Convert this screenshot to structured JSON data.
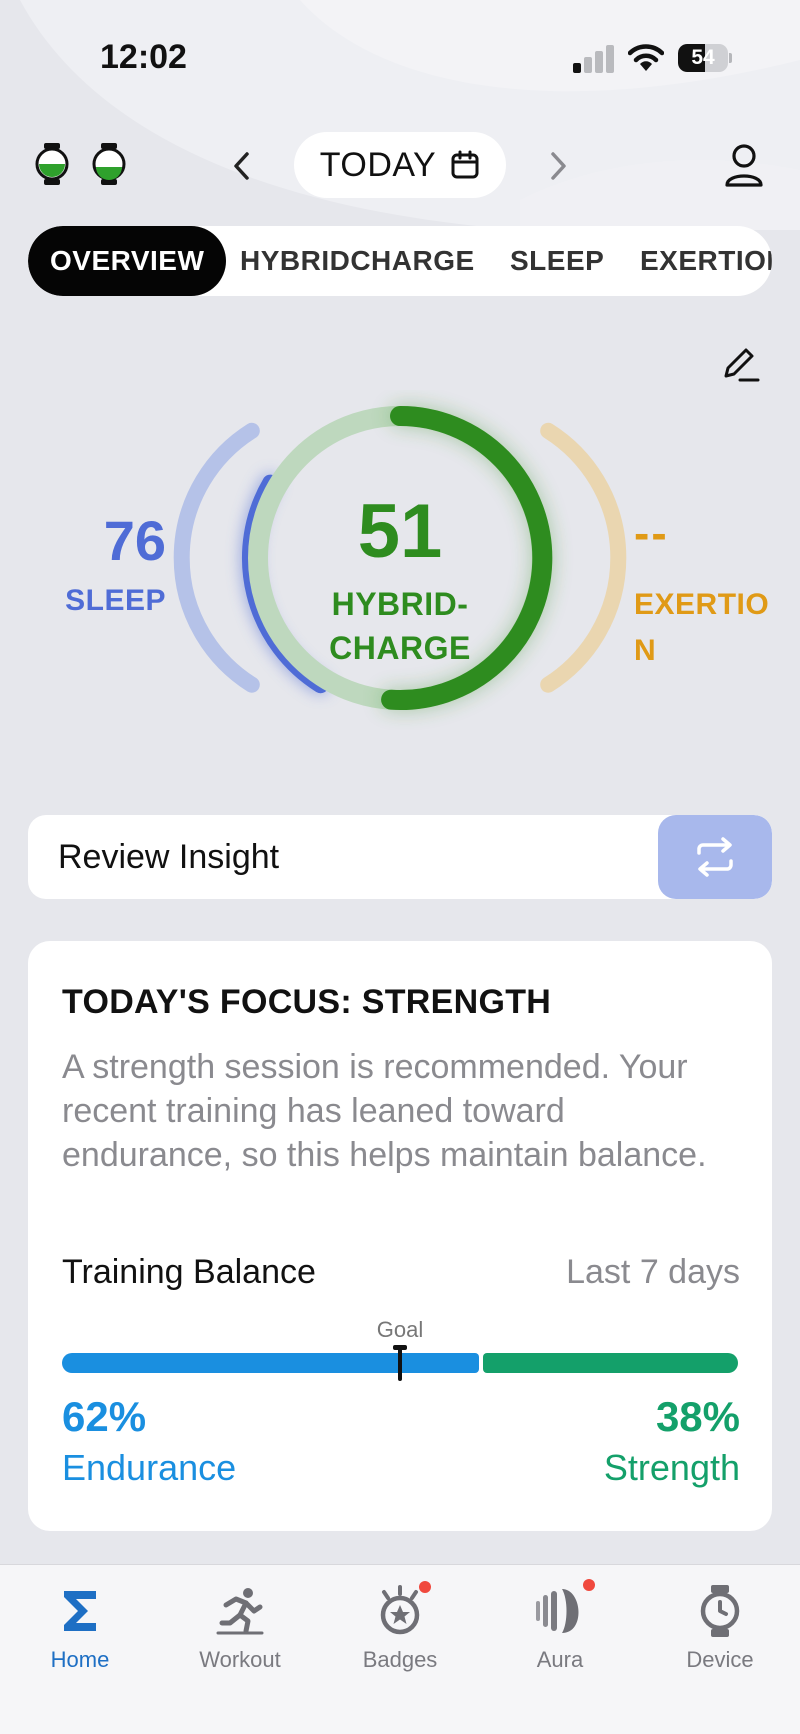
{
  "status_bar": {
    "time": "12:02",
    "battery": "54",
    "battery_level_percent": 54
  },
  "header": {
    "date_label": "TODAY",
    "icons": [
      "watch-icon",
      "watch-icon",
      "chevron-left-icon",
      "calendar-icon",
      "chevron-right-icon",
      "profile-icon"
    ]
  },
  "tabs": [
    {
      "label": "OVERVIEW",
      "active": true
    },
    {
      "label": "HYBRIDCHARGE",
      "active": false
    },
    {
      "label": "SLEEP",
      "active": false
    },
    {
      "label": "EXERTION",
      "active": false
    }
  ],
  "scores": {
    "sleep": {
      "value": "76",
      "label": "SLEEP",
      "color": "#4f6cd6"
    },
    "hybridcharge": {
      "value": "51",
      "label_line1": "HYBRID-",
      "label_line2": "CHARGE",
      "fill_percent": 51,
      "color": "#2e8c1f"
    },
    "exertion": {
      "value": "--",
      "label": "EXERTION",
      "color": "#e09a16"
    }
  },
  "review": {
    "label": "Review Insight"
  },
  "focus": {
    "title": "TODAY'S FOCUS: STRENGTH",
    "description": "A strength session is recommended. Your recent training has leaned toward endurance, so this helps maintain balance.",
    "balance_title": "Training Balance",
    "balance_period": "Last 7 days",
    "goal_label": "Goal",
    "goal_percent": 50,
    "endurance": {
      "percent": "62%",
      "value": 62,
      "label": "Endurance",
      "color": "#1a8fe0"
    },
    "strength": {
      "percent": "38%",
      "value": 38,
      "label": "Strength",
      "color": "#14a06a"
    }
  },
  "bottom_nav": [
    {
      "label": "Home",
      "icon": "sigma-icon",
      "active": true,
      "badge": false
    },
    {
      "label": "Workout",
      "icon": "running-icon",
      "active": false,
      "badge": false
    },
    {
      "label": "Badges",
      "icon": "medal-icon",
      "active": false,
      "badge": true
    },
    {
      "label": "Aura",
      "icon": "aura-icon",
      "active": false,
      "badge": true
    },
    {
      "label": "Device",
      "icon": "watch-icon",
      "active": false,
      "badge": false
    }
  ]
}
